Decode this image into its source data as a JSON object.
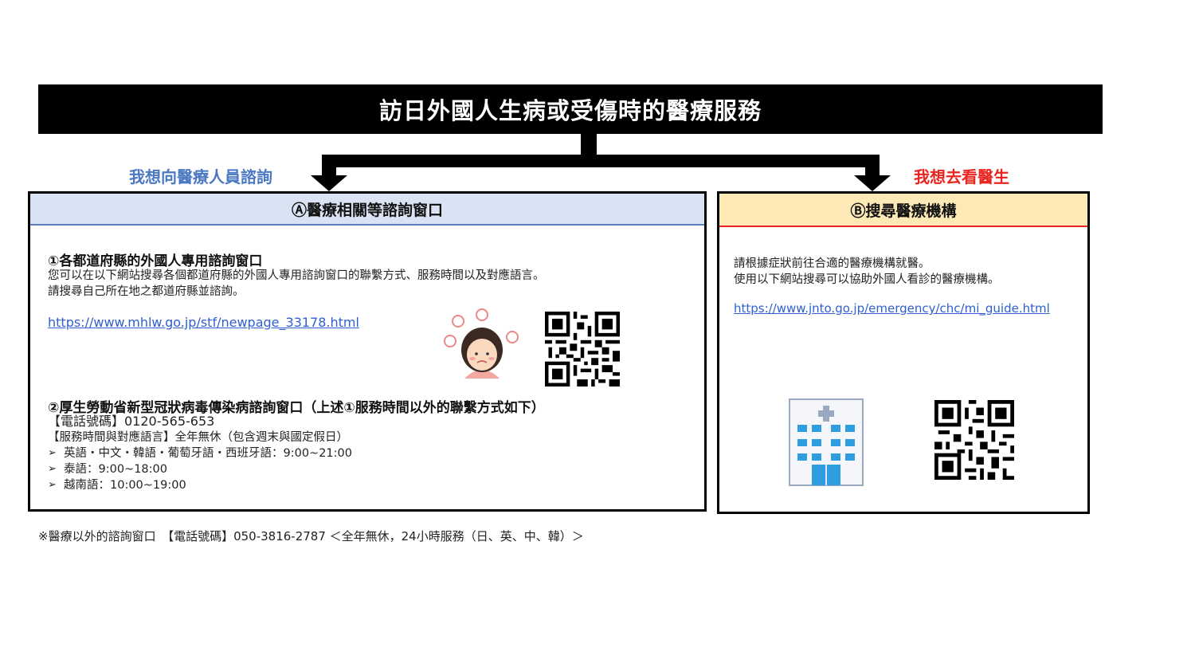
{
  "title": "訪日外國人生病或受傷時的醫療服務",
  "branches": {
    "left_label": "我想向醫療人員諮詢",
    "right_label": "我想去看醫生"
  },
  "panel_a": {
    "header": "Ⓐ醫療相關等諮詢窗口",
    "section1": {
      "heading": "①各都道府縣的外國人專用諮詢窗口",
      "line1": "您可以在以下網站搜尋各個都道府縣的外國人專用諮詢窗口的聯繫方式、服務時間以及對應語言。",
      "line2": "請搜尋自己所在地之都道府縣並諮詢。",
      "link": "https://www.mhlw.go.jp/stf/newpage_33178.html"
    },
    "section2": {
      "heading": "②厚生勞動省新型冠狀病毒傳染病諮詢窗口（上述①服務時間以外的聯繫方式如下）",
      "phone": "【電話號碼】0120-565-653",
      "hours": "【服務時間與對應語言】全年無休（包含週末與國定假日）",
      "bullets": [
        "英語・中文・韓語・葡萄牙語・西班牙語：9:00~21:00",
        "泰語：9:00~18:00",
        "越南語：10:00~19:00"
      ]
    }
  },
  "panel_b": {
    "header": "Ⓑ搜尋醫療機構",
    "line1": "請根據症狀前往合適的醫療機構就醫。",
    "line2": "使用以下網站搜尋可以協助外國人看診的醫療機構。",
    "link": "https://www.jnto.go.jp/emergency/chc/mi_guide.html"
  },
  "footer": "※醫療以外的諮詢窗口　【電話號碼】050-3816-2787 ＜全年無休，24小時服務（日、英、中、韓）＞",
  "colors": {
    "title_bg": "#000000",
    "left_label": "#4a78c2",
    "right_label": "#e8251f",
    "panel_a_header_bg": "#dae3f3",
    "panel_b_header_bg": "#fde9b6",
    "link": "#2f5fd0"
  },
  "icons": [
    "sick-woman-illustration",
    "qr-code-icon",
    "hospital-building-icon"
  ]
}
